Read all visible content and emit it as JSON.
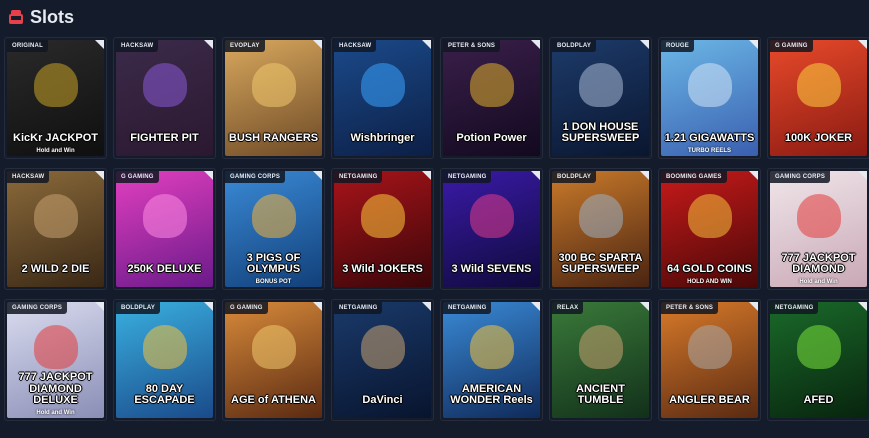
{
  "header": {
    "title": "Slots",
    "icon": "slot-machine-icon",
    "icon_color": "#e8404a"
  },
  "games": [
    {
      "provider": "ORIGINAL",
      "title": "KicKr JACKPOT",
      "sub": "Hold and Win",
      "bg": "linear-gradient(160deg,#2a2a2a,#0f0f0f)",
      "fig": "#c9a227"
    },
    {
      "provider": "HACKSAW",
      "title": "FIGHTER PIT",
      "sub": "",
      "bg": "linear-gradient(160deg,#3b2a4a,#2b1830)",
      "fig": "#8a5ad6"
    },
    {
      "provider": "EVOPLAY",
      "title": "BUSH RANGERS",
      "sub": "",
      "bg": "linear-gradient(160deg,#d8a85e,#6e4a26)",
      "fig": "#f0c86e"
    },
    {
      "provider": "HACKSAW",
      "title": "Wishbringer",
      "sub": "",
      "bg": "linear-gradient(160deg,#1b4a8a,#0c1f46)",
      "fig": "#39a3ff"
    },
    {
      "provider": "PETER & SONS",
      "title": "Potion Power",
      "sub": "",
      "bg": "linear-gradient(160deg,#3a1f4a,#12091f)",
      "fig": "#e0b12b"
    },
    {
      "provider": "BOLDPLAY",
      "title": "1 DON HOUSE SUPERSWEEP",
      "sub": "",
      "bg": "linear-gradient(160deg,#1d3b6a,#0a1630)",
      "fig": "#a9b9d6"
    },
    {
      "provider": "ROUGE",
      "title": "1.21 GIGAWATTS",
      "sub": "TURBO REELS",
      "bg": "linear-gradient(160deg,#6bb7e6,#3a5fb0)",
      "fig": "#d4e5f7"
    },
    {
      "provider": "G GAMING",
      "title": "100K JOKER",
      "sub": "",
      "bg": "linear-gradient(160deg,#e84a2a,#8a1a12)",
      "fig": "#ffd23f"
    },
    {
      "provider": "HACKSAW",
      "title": "2 WILD 2 DIE",
      "sub": "",
      "bg": "linear-gradient(160deg,#8a6a3a,#3a2816)",
      "fig": "#c9a271"
    },
    {
      "provider": "G GAMING",
      "title": "250K DELUXE",
      "sub": "",
      "bg": "linear-gradient(160deg,#e23fbf,#6a1a8a)",
      "fig": "#ff8ae3"
    },
    {
      "provider": "GAMING CORPS",
      "title": "3 PIGS OF OLYMPUS",
      "sub": "BONUS POT",
      "bg": "linear-gradient(160deg,#3a8ad6,#12407a)",
      "fig": "#f5b33b"
    },
    {
      "provider": "NETGAMING",
      "title": "3 Wild JOKERS",
      "sub": "",
      "bg": "linear-gradient(160deg,#a8141a,#3a0609)",
      "fig": "#ffcb3a"
    },
    {
      "provider": "NETGAMING",
      "title": "3 Wild SEVENS",
      "sub": "",
      "bg": "linear-gradient(160deg,#3a1aa8,#0f0a3a)",
      "fig": "#e23a8a"
    },
    {
      "provider": "BOLDPLAY",
      "title": "300 BC SPARTA SUPERSWEEP",
      "sub": "",
      "bg": "linear-gradient(160deg,#c97a2a,#4a2412)",
      "fig": "#9db0c4"
    },
    {
      "provider": "BOOMING GAMES",
      "title": "64 GOLD COINS",
      "sub": "HOLD AND WIN",
      "bg": "linear-gradient(160deg,#c81a1a,#4a0808)",
      "fig": "#f5c23b"
    },
    {
      "provider": "GAMING CORPS",
      "title": "777 JACKPOT DIAMOND",
      "sub": "Hold and Win",
      "bg": "linear-gradient(160deg,#f0e6ea,#c9a8b6)",
      "fig": "#e23a3a"
    },
    {
      "provider": "GAMING CORPS",
      "title": "777 JACKPOT DIAMOND DELUXE",
      "sub": "Hold and Win",
      "bg": "linear-gradient(160deg,#dadcef,#8a8eb6)",
      "fig": "#e23a3a"
    },
    {
      "provider": "BOLDPLAY",
      "title": "80 DAY ESCAPADE",
      "sub": "",
      "bg": "linear-gradient(160deg,#3ab0e0,#1a4a8a)",
      "fig": "#f5c23b"
    },
    {
      "provider": "G GAMING",
      "title": "AGE of ATHENA",
      "sub": "",
      "bg": "linear-gradient(160deg,#d88a3a,#5a2a12)",
      "fig": "#f0c86e"
    },
    {
      "provider": "NETGAMING",
      "title": "DaVinci",
      "sub": "",
      "bg": "linear-gradient(160deg,#1a3a6a,#08142e)",
      "fig": "#c9a271"
    },
    {
      "provider": "NETGAMING",
      "title": "AMERICAN WONDER Reels",
      "sub": "",
      "bg": "linear-gradient(160deg,#3a8ad6,#0f2a5a)",
      "fig": "#f5c23b"
    },
    {
      "provider": "RELAX",
      "title": "ANCIENT TUMBLE",
      "sub": "",
      "bg": "linear-gradient(160deg,#3a7a3a,#12301a)",
      "fig": "#c9a271"
    },
    {
      "provider": "PETER & SONS",
      "title": "ANGLER BEAR",
      "sub": "",
      "bg": "linear-gradient(160deg,#d87a2a,#5a2a12)",
      "fig": "#a9a9a9"
    },
    {
      "provider": "NETGAMING",
      "title": "AFED",
      "sub": "",
      "bg": "linear-gradient(160deg,#1a6a2a,#08240e)",
      "fig": "#7ae23a"
    }
  ]
}
